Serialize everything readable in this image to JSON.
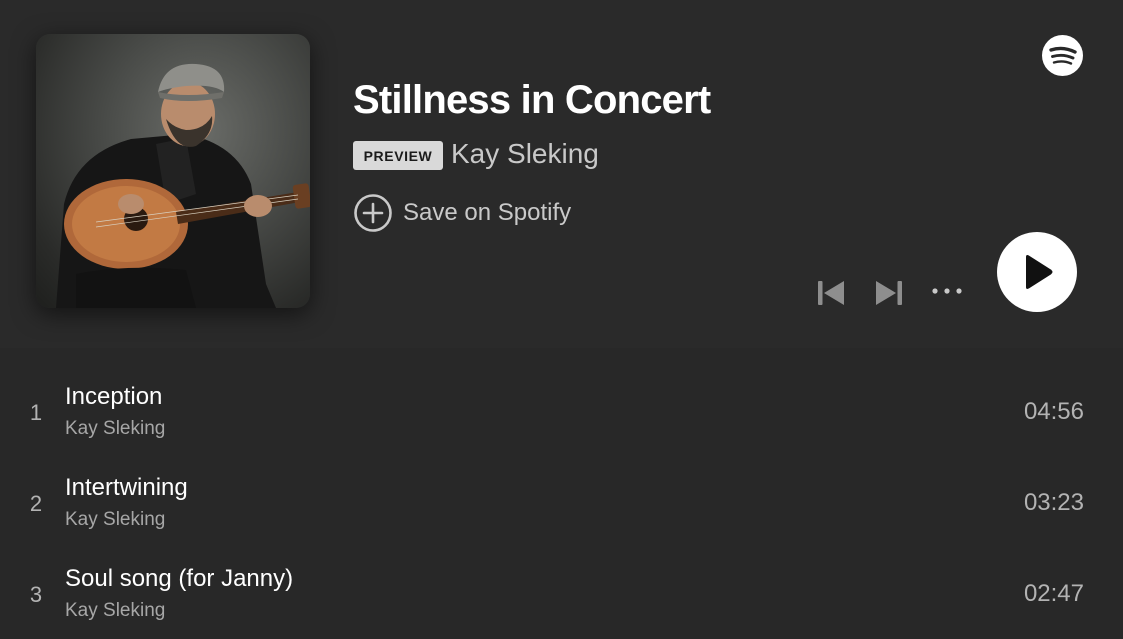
{
  "album": {
    "title": "Stillness in Concert",
    "badge": "PREVIEW",
    "artist": "Kay Sleking",
    "cover_alt": "Album cover: guitarist in a flat cap playing acoustic guitar"
  },
  "actions": {
    "save_label": "Save on Spotify",
    "plus_icon": "plus-circle-icon",
    "prev_icon": "skip-previous-icon",
    "next_icon": "skip-next-icon",
    "more_icon": "more-horizontal-icon",
    "play_icon": "play-icon",
    "logo_icon": "spotify-logo-icon"
  },
  "tracks": [
    {
      "number": "1",
      "title": "Inception",
      "artist": "Kay Sleking",
      "duration": "04:56"
    },
    {
      "number": "2",
      "title": "Intertwining",
      "artist": "Kay Sleking",
      "duration": "03:23"
    },
    {
      "number": "3",
      "title": "Soul song (for Janny)",
      "artist": "Kay Sleking",
      "duration": "02:47"
    }
  ],
  "colors": {
    "background": "#282828",
    "header": "#2a2a2a",
    "text_primary": "#ffffff",
    "text_secondary": "#b3b3b3",
    "badge_bg": "#d9d9d9",
    "play_button": "#ffffff"
  }
}
